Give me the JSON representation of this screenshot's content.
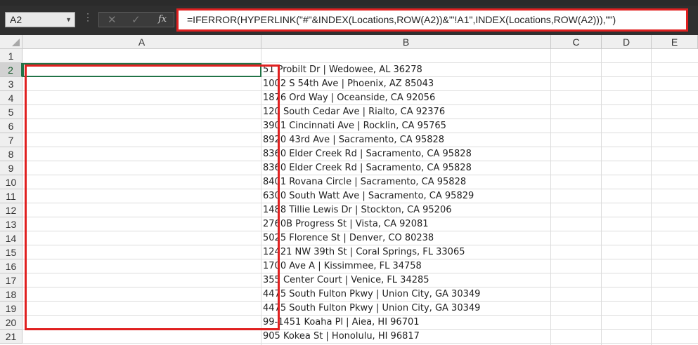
{
  "name_box": {
    "value": "A2",
    "dropdown_icon": "chevron-down-icon"
  },
  "formula_bar": {
    "cancel_icon": "cancel-x-icon",
    "enter_icon": "checkmark-icon",
    "fx_label": "fx",
    "formula": "=IFERROR(HYPERLINK(\"#\"&INDEX(Locations,ROW(A2))&\"'!A1\",INDEX(Locations,ROW(A2))),\"\")"
  },
  "columns": [
    "A",
    "B",
    "C",
    "D",
    "E"
  ],
  "rows": [
    "1",
    "2",
    "3",
    "4",
    "5",
    "6",
    "7",
    "8",
    "9",
    "10",
    "11",
    "12",
    "13",
    "14",
    "15",
    "16",
    "17",
    "18",
    "19",
    "20",
    "21"
  ],
  "column_b": [
    "",
    "51 Probilt Dr | Wedowee, AL 36278",
    "1002 S 54th Ave | Phoenix, AZ 85043",
    "1876 Ord Way | Oceanside, CA 92056",
    "120 South Cedar Ave | Rialto, CA 92376",
    "3901 Cincinnati Ave | Rocklin, CA 95765",
    "8920 43rd Ave | Sacramento, CA 95828",
    "8360 Elder Creek Rd | Sacramento, CA 95828",
    "8360 Elder Creek Rd | Sacramento, CA 95828",
    "8401 Rovana Circle | Sacramento, CA 95828",
    "6300 South Watt Ave | Sacramento, CA 95829",
    "1488 Tillie Lewis Dr | Stockton, CA 95206",
    "2760B Progress St | Vista, CA 92081",
    "5025 Florence St | Denver, CO 80238",
    "12421 NW 39th St | Coral Springs, FL 33065",
    "1700 Ave A | Kissimmee, FL 34758",
    "355 Center Court | Venice, FL 34285",
    "4475 South Fulton Pkwy | Union City, GA 30349",
    "4475 South Fulton Pkwy | Union City, GA 30349",
    "99-1451 Koaha Pl | Aiea, HI 96701",
    "905 Kokea St | Honolulu, HI 96817"
  ],
  "colors": {
    "highlight_red": "#e02020",
    "selection_green": "#217346"
  }
}
